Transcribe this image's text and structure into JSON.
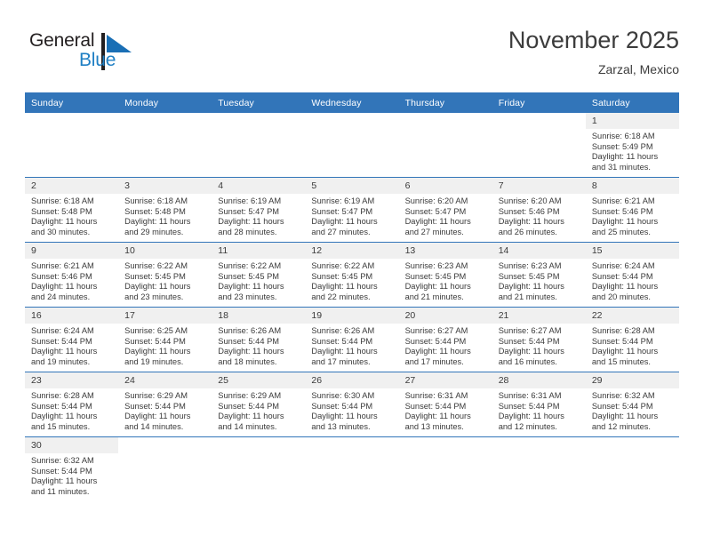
{
  "brand": {
    "name_part1": "General",
    "name_part2": "Blue",
    "mark": "triangle-logo-icon",
    "colors": {
      "dark": "#231f20",
      "blue": "#1f7fc4"
    }
  },
  "header": {
    "title": "November 2025",
    "location": "Zarzal, Mexico"
  },
  "theme": {
    "header_bg": "#3275b9",
    "daynum_bg": "#f0f0f0",
    "row_rule": "#3275b9",
    "text": "#3a3a3a"
  },
  "weekdays": [
    "Sunday",
    "Monday",
    "Tuesday",
    "Wednesday",
    "Thursday",
    "Friday",
    "Saturday"
  ],
  "labels": {
    "sunrise_prefix": "Sunrise:",
    "sunset_prefix": "Sunset:",
    "daylight_prefix": "Daylight:"
  },
  "weeks": [
    [
      {
        "empty": true
      },
      {
        "empty": true
      },
      {
        "empty": true
      },
      {
        "empty": true
      },
      {
        "empty": true
      },
      {
        "empty": true
      },
      {
        "day": "1",
        "sunrise": "Sunrise: 6:18 AM",
        "sunset": "Sunset: 5:49 PM",
        "daylight1": "Daylight: 11 hours",
        "daylight2": "and 31 minutes."
      }
    ],
    [
      {
        "day": "2",
        "sunrise": "Sunrise: 6:18 AM",
        "sunset": "Sunset: 5:48 PM",
        "daylight1": "Daylight: 11 hours",
        "daylight2": "and 30 minutes."
      },
      {
        "day": "3",
        "sunrise": "Sunrise: 6:18 AM",
        "sunset": "Sunset: 5:48 PM",
        "daylight1": "Daylight: 11 hours",
        "daylight2": "and 29 minutes."
      },
      {
        "day": "4",
        "sunrise": "Sunrise: 6:19 AM",
        "sunset": "Sunset: 5:47 PM",
        "daylight1": "Daylight: 11 hours",
        "daylight2": "and 28 minutes."
      },
      {
        "day": "5",
        "sunrise": "Sunrise: 6:19 AM",
        "sunset": "Sunset: 5:47 PM",
        "daylight1": "Daylight: 11 hours",
        "daylight2": "and 27 minutes."
      },
      {
        "day": "6",
        "sunrise": "Sunrise: 6:20 AM",
        "sunset": "Sunset: 5:47 PM",
        "daylight1": "Daylight: 11 hours",
        "daylight2": "and 27 minutes."
      },
      {
        "day": "7",
        "sunrise": "Sunrise: 6:20 AM",
        "sunset": "Sunset: 5:46 PM",
        "daylight1": "Daylight: 11 hours",
        "daylight2": "and 26 minutes."
      },
      {
        "day": "8",
        "sunrise": "Sunrise: 6:21 AM",
        "sunset": "Sunset: 5:46 PM",
        "daylight1": "Daylight: 11 hours",
        "daylight2": "and 25 minutes."
      }
    ],
    [
      {
        "day": "9",
        "sunrise": "Sunrise: 6:21 AM",
        "sunset": "Sunset: 5:46 PM",
        "daylight1": "Daylight: 11 hours",
        "daylight2": "and 24 minutes."
      },
      {
        "day": "10",
        "sunrise": "Sunrise: 6:22 AM",
        "sunset": "Sunset: 5:45 PM",
        "daylight1": "Daylight: 11 hours",
        "daylight2": "and 23 minutes."
      },
      {
        "day": "11",
        "sunrise": "Sunrise: 6:22 AM",
        "sunset": "Sunset: 5:45 PM",
        "daylight1": "Daylight: 11 hours",
        "daylight2": "and 23 minutes."
      },
      {
        "day": "12",
        "sunrise": "Sunrise: 6:22 AM",
        "sunset": "Sunset: 5:45 PM",
        "daylight1": "Daylight: 11 hours",
        "daylight2": "and 22 minutes."
      },
      {
        "day": "13",
        "sunrise": "Sunrise: 6:23 AM",
        "sunset": "Sunset: 5:45 PM",
        "daylight1": "Daylight: 11 hours",
        "daylight2": "and 21 minutes."
      },
      {
        "day": "14",
        "sunrise": "Sunrise: 6:23 AM",
        "sunset": "Sunset: 5:45 PM",
        "daylight1": "Daylight: 11 hours",
        "daylight2": "and 21 minutes."
      },
      {
        "day": "15",
        "sunrise": "Sunrise: 6:24 AM",
        "sunset": "Sunset: 5:44 PM",
        "daylight1": "Daylight: 11 hours",
        "daylight2": "and 20 minutes."
      }
    ],
    [
      {
        "day": "16",
        "sunrise": "Sunrise: 6:24 AM",
        "sunset": "Sunset: 5:44 PM",
        "daylight1": "Daylight: 11 hours",
        "daylight2": "and 19 minutes."
      },
      {
        "day": "17",
        "sunrise": "Sunrise: 6:25 AM",
        "sunset": "Sunset: 5:44 PM",
        "daylight1": "Daylight: 11 hours",
        "daylight2": "and 19 minutes."
      },
      {
        "day": "18",
        "sunrise": "Sunrise: 6:26 AM",
        "sunset": "Sunset: 5:44 PM",
        "daylight1": "Daylight: 11 hours",
        "daylight2": "and 18 minutes."
      },
      {
        "day": "19",
        "sunrise": "Sunrise: 6:26 AM",
        "sunset": "Sunset: 5:44 PM",
        "daylight1": "Daylight: 11 hours",
        "daylight2": "and 17 minutes."
      },
      {
        "day": "20",
        "sunrise": "Sunrise: 6:27 AM",
        "sunset": "Sunset: 5:44 PM",
        "daylight1": "Daylight: 11 hours",
        "daylight2": "and 17 minutes."
      },
      {
        "day": "21",
        "sunrise": "Sunrise: 6:27 AM",
        "sunset": "Sunset: 5:44 PM",
        "daylight1": "Daylight: 11 hours",
        "daylight2": "and 16 minutes."
      },
      {
        "day": "22",
        "sunrise": "Sunrise: 6:28 AM",
        "sunset": "Sunset: 5:44 PM",
        "daylight1": "Daylight: 11 hours",
        "daylight2": "and 15 minutes."
      }
    ],
    [
      {
        "day": "23",
        "sunrise": "Sunrise: 6:28 AM",
        "sunset": "Sunset: 5:44 PM",
        "daylight1": "Daylight: 11 hours",
        "daylight2": "and 15 minutes."
      },
      {
        "day": "24",
        "sunrise": "Sunrise: 6:29 AM",
        "sunset": "Sunset: 5:44 PM",
        "daylight1": "Daylight: 11 hours",
        "daylight2": "and 14 minutes."
      },
      {
        "day": "25",
        "sunrise": "Sunrise: 6:29 AM",
        "sunset": "Sunset: 5:44 PM",
        "daylight1": "Daylight: 11 hours",
        "daylight2": "and 14 minutes."
      },
      {
        "day": "26",
        "sunrise": "Sunrise: 6:30 AM",
        "sunset": "Sunset: 5:44 PM",
        "daylight1": "Daylight: 11 hours",
        "daylight2": "and 13 minutes."
      },
      {
        "day": "27",
        "sunrise": "Sunrise: 6:31 AM",
        "sunset": "Sunset: 5:44 PM",
        "daylight1": "Daylight: 11 hours",
        "daylight2": "and 13 minutes."
      },
      {
        "day": "28",
        "sunrise": "Sunrise: 6:31 AM",
        "sunset": "Sunset: 5:44 PM",
        "daylight1": "Daylight: 11 hours",
        "daylight2": "and 12 minutes."
      },
      {
        "day": "29",
        "sunrise": "Sunrise: 6:32 AM",
        "sunset": "Sunset: 5:44 PM",
        "daylight1": "Daylight: 11 hours",
        "daylight2": "and 12 minutes."
      }
    ],
    [
      {
        "day": "30",
        "sunrise": "Sunrise: 6:32 AM",
        "sunset": "Sunset: 5:44 PM",
        "daylight1": "Daylight: 11 hours",
        "daylight2": "and 11 minutes."
      },
      {
        "empty": true
      },
      {
        "empty": true
      },
      {
        "empty": true
      },
      {
        "empty": true
      },
      {
        "empty": true
      },
      {
        "empty": true
      }
    ]
  ]
}
